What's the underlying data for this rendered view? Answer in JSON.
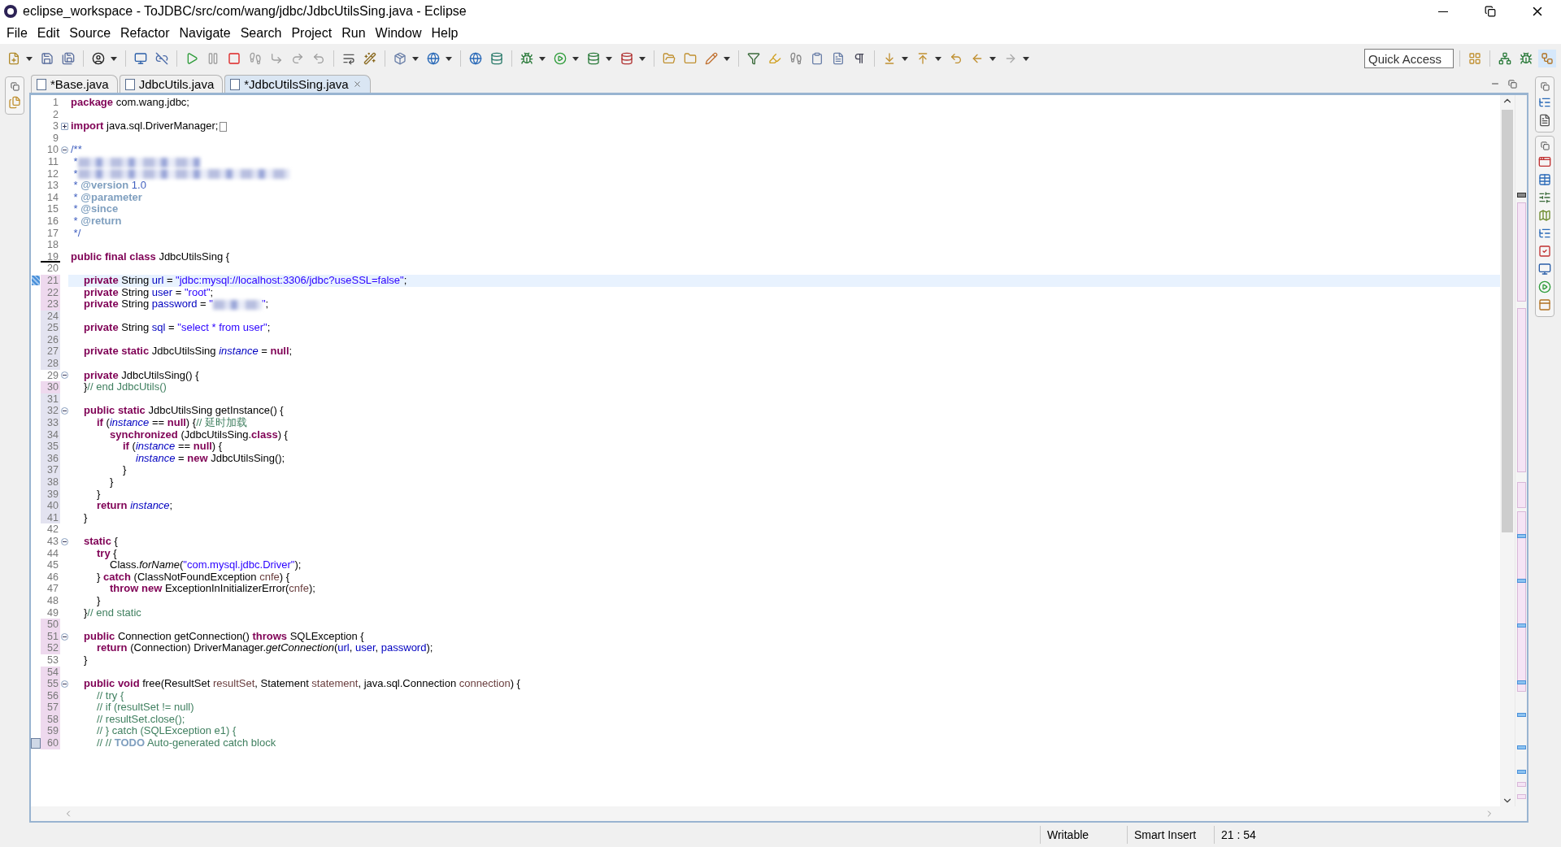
{
  "window": {
    "title": "eclipse_workspace - ToJDBC/src/com/wang/jdbc/JdbcUtilsSing.java - Eclipse"
  },
  "menu": [
    "File",
    "Edit",
    "Source",
    "Refactor",
    "Navigate",
    "Search",
    "Project",
    "Run",
    "Window",
    "Help"
  ],
  "quick_access": {
    "placeholder": "Quick Access"
  },
  "tabs": [
    {
      "label": "*Base.java",
      "selected": false
    },
    {
      "label": "JdbcUtils.java",
      "selected": false
    },
    {
      "label": "*JdbcUtilsSing.java",
      "selected": true
    }
  ],
  "lines": [
    {
      "n": "1",
      "tokens": [
        {
          "t": "package",
          "kind": "kw"
        },
        {
          "t": " com.wang.jdbc;",
          "kind": "plain"
        }
      ]
    },
    {
      "n": "2"
    },
    {
      "n": "3",
      "expanded": false,
      "tokens": [
        {
          "t": "import",
          "kind": "kw"
        },
        {
          "t": " java.sql.DriverManager;",
          "kind": "plain"
        }
      ]
    },
    {
      "n": "9"
    },
    {
      "n": "10",
      "expanded": true,
      "tokens": [
        {
          "t": "/**",
          "kind": "jd"
        }
      ]
    },
    {
      "n": "11",
      "tokens": [
        {
          "t": " *",
          "kind": "jd"
        },
        {
          "redacted": true,
          "kind": "jd"
        }
      ]
    },
    {
      "n": "12",
      "tokens": [
        {
          "t": " *",
          "kind": "jd"
        },
        {
          "redacted": true,
          "kind": "jd"
        }
      ]
    },
    {
      "n": "13",
      "tokens": [
        {
          "t": " * ",
          "kind": "jd"
        },
        {
          "t": "@version",
          "kind": "tag"
        },
        {
          "t": " 1.0",
          "kind": "jd"
        }
      ]
    },
    {
      "n": "14",
      "tokens": [
        {
          "t": " * ",
          "kind": "jd"
        },
        {
          "t": "@parameter",
          "kind": "tag"
        }
      ]
    },
    {
      "n": "15",
      "tokens": [
        {
          "t": " * ",
          "kind": "jd"
        },
        {
          "t": "@since",
          "kind": "tag"
        }
      ]
    },
    {
      "n": "16",
      "tokens": [
        {
          "t": " * ",
          "kind": "jd"
        },
        {
          "t": "@return",
          "kind": "tag"
        }
      ]
    },
    {
      "n": "17",
      "tokens": [
        {
          "t": " */",
          "kind": "jd"
        }
      ]
    },
    {
      "n": "18"
    },
    {
      "n": "19",
      "kind": "deleted",
      "tokens": [
        {
          "t": "public final class",
          "kind": "kw"
        },
        {
          "t": " JdbcUtilsSing {",
          "kind": "plain"
        }
      ]
    },
    {
      "n": "20"
    },
    {
      "n": "21",
      "current": true,
      "kind": "changed",
      "tokens": [
        {
          "t": "\tprivate",
          "kind": "kw"
        },
        {
          "t": " String ",
          "kind": "plain"
        },
        {
          "t": "url",
          "kind": "field"
        },
        {
          "t": " = ",
          "kind": "plain"
        },
        {
          "t": "\"jdbc:mysql://localhost:3306/jdbc?useSSL=false\"",
          "kind": "str"
        },
        {
          "t": ";",
          "kind": "plain"
        }
      ]
    },
    {
      "n": "22",
      "kind": "changed",
      "tokens": [
        {
          "t": "\tprivate",
          "kind": "kw"
        },
        {
          "t": " String ",
          "kind": "plain"
        },
        {
          "t": "user",
          "kind": "field"
        },
        {
          "t": " = ",
          "kind": "plain"
        },
        {
          "t": "\"root\"",
          "kind": "str"
        },
        {
          "t": ";",
          "kind": "plain"
        }
      ]
    },
    {
      "n": "23",
      "kind": "changed",
      "tokens": [
        {
          "t": "\tprivate",
          "kind": "kw"
        },
        {
          "t": " String ",
          "kind": "plain"
        },
        {
          "t": "password",
          "kind": "field"
        },
        {
          "t": " = ",
          "kind": "plain"
        },
        {
          "t": "\"",
          "kind": "str"
        },
        {
          "redacted": true,
          "kind": "str"
        },
        {
          "t": "\"",
          "kind": "str"
        },
        {
          "t": ";",
          "kind": "plain"
        }
      ]
    },
    {
      "n": "24",
      "kind": "added"
    },
    {
      "n": "25",
      "kind": "added",
      "tokens": [
        {
          "t": "\tprivate",
          "kind": "kw"
        },
        {
          "t": " String ",
          "kind": "plain"
        },
        {
          "t": "sql",
          "kind": "field"
        },
        {
          "t": " = ",
          "kind": "plain"
        },
        {
          "t": "\"select * from user\"",
          "kind": "str"
        },
        {
          "t": ";",
          "kind": "plain"
        }
      ]
    },
    {
      "n": "26",
      "kind": "added"
    },
    {
      "n": "27",
      "kind": "added",
      "tokens": [
        {
          "t": "\tprivate static",
          "kind": "kw"
        },
        {
          "t": " JdbcUtilsSing ",
          "kind": "plain"
        },
        {
          "t": "instance",
          "kind": "sfield"
        },
        {
          "t": " = ",
          "kind": "plain"
        },
        {
          "t": "null",
          "kind": "kw"
        },
        {
          "t": ";",
          "kind": "plain"
        }
      ]
    },
    {
      "n": "28",
      "kind": "added"
    },
    {
      "n": "29",
      "expanded": true,
      "tokens": [
        {
          "t": "\tprivate",
          "kind": "kw"
        },
        {
          "t": " JdbcUtilsSing() {",
          "kind": "plain"
        }
      ]
    },
    {
      "n": "30",
      "kind": "changed",
      "tokens": [
        {
          "t": "\t}",
          "kind": "plain"
        },
        {
          "t": "// end JdbcUtils()",
          "kind": "cm"
        }
      ]
    },
    {
      "n": "31",
      "kind": "added"
    },
    {
      "n": "32",
      "kind": "added",
      "expanded": true,
      "tokens": [
        {
          "t": "\tpublic static",
          "kind": "kw"
        },
        {
          "t": " JdbcUtilsSing getInstance() {",
          "kind": "plain"
        }
      ]
    },
    {
      "n": "33",
      "kind": "added",
      "tokens": [
        {
          "t": "\t\tif",
          "kind": "kw"
        },
        {
          "t": " (",
          "kind": "plain"
        },
        {
          "t": "instance",
          "kind": "sfield"
        },
        {
          "t": " == ",
          "kind": "plain"
        },
        {
          "t": "null",
          "kind": "kw"
        },
        {
          "t": ") {",
          "kind": "plain"
        },
        {
          "t": "// 延时加载",
          "kind": "cm"
        }
      ]
    },
    {
      "n": "34",
      "kind": "added",
      "tokens": [
        {
          "t": "\t\t\tsynchronized",
          "kind": "kw"
        },
        {
          "t": " (JdbcUtilsSing.",
          "kind": "plain"
        },
        {
          "t": "class",
          "kind": "kw"
        },
        {
          "t": ") {",
          "kind": "plain"
        }
      ]
    },
    {
      "n": "35",
      "kind": "added",
      "tokens": [
        {
          "t": "\t\t\t\tif",
          "kind": "kw"
        },
        {
          "t": " (",
          "kind": "plain"
        },
        {
          "t": "instance",
          "kind": "sfield"
        },
        {
          "t": " == ",
          "kind": "plain"
        },
        {
          "t": "null",
          "kind": "kw"
        },
        {
          "t": ") {",
          "kind": "plain"
        }
      ]
    },
    {
      "n": "36",
      "kind": "added",
      "tokens": [
        {
          "t": "\t\t\t\t\tinstance",
          "kind": "sfield"
        },
        {
          "t": " = ",
          "kind": "plain"
        },
        {
          "t": "new",
          "kind": "kw"
        },
        {
          "t": " JdbcUtilsSing();",
          "kind": "plain"
        }
      ]
    },
    {
      "n": "37",
      "kind": "added",
      "tokens": [
        {
          "t": "\t\t\t\t}",
          "kind": "plain"
        }
      ]
    },
    {
      "n": "38",
      "kind": "added",
      "tokens": [
        {
          "t": "\t\t\t}",
          "kind": "plain"
        }
      ]
    },
    {
      "n": "39",
      "kind": "added",
      "tokens": [
        {
          "t": "\t\t}",
          "kind": "plain"
        }
      ]
    },
    {
      "n": "40",
      "kind": "added",
      "tokens": [
        {
          "t": "\t\treturn ",
          "kind": "kw"
        },
        {
          "t": "instance",
          "kind": "sfield"
        },
        {
          "t": ";",
          "kind": "plain"
        }
      ]
    },
    {
      "n": "41",
      "kind": "added",
      "tokens": [
        {
          "t": "\t}",
          "kind": "plain"
        }
      ]
    },
    {
      "n": "42"
    },
    {
      "n": "43",
      "expanded": true,
      "tokens": [
        {
          "t": "\tstatic",
          "kind": "kw"
        },
        {
          "t": " {",
          "kind": "plain"
        }
      ]
    },
    {
      "n": "44",
      "tokens": [
        {
          "t": "\t\ttry",
          "kind": "kw"
        },
        {
          "t": " {",
          "kind": "plain"
        }
      ]
    },
    {
      "n": "45",
      "tokens": [
        {
          "t": "\t\t\tClass.",
          "kind": "plain"
        },
        {
          "t": "forName",
          "kind": "smethod"
        },
        {
          "t": "(",
          "kind": "plain"
        },
        {
          "t": "\"com.mysql.jdbc.Driver\"",
          "kind": "str"
        },
        {
          "t": ");",
          "kind": "plain"
        }
      ]
    },
    {
      "n": "46",
      "tokens": [
        {
          "t": "\t\t} ",
          "kind": "plain"
        },
        {
          "t": "catch",
          "kind": "kw"
        },
        {
          "t": " (ClassNotFoundException ",
          "kind": "plain"
        },
        {
          "t": "cnfe",
          "kind": "local"
        },
        {
          "t": ") {",
          "kind": "plain"
        }
      ]
    },
    {
      "n": "47",
      "tokens": [
        {
          "t": "\t\t\tthrow new",
          "kind": "kw"
        },
        {
          "t": " ExceptionInInitializerError(",
          "kind": "plain"
        },
        {
          "t": "cnfe",
          "kind": "local"
        },
        {
          "t": ");",
          "kind": "plain"
        }
      ]
    },
    {
      "n": "48",
      "tokens": [
        {
          "t": "\t\t}",
          "kind": "plain"
        }
      ]
    },
    {
      "n": "49",
      "tokens": [
        {
          "t": "\t}",
          "kind": "plain"
        },
        {
          "t": "// end static",
          "kind": "cm"
        }
      ]
    },
    {
      "n": "50",
      "kind": "changed"
    },
    {
      "n": "51",
      "kind": "changed",
      "expanded": true,
      "tokens": [
        {
          "t": "\tpublic",
          "kind": "kw"
        },
        {
          "t": " Connection getConnection() ",
          "kind": "plain"
        },
        {
          "t": "throws",
          "kind": "kw"
        },
        {
          "t": " SQLException {",
          "kind": "plain"
        }
      ]
    },
    {
      "n": "52",
      "kind": "changed",
      "tokens": [
        {
          "t": "\t\treturn",
          "kind": "kw"
        },
        {
          "t": " (Connection) DriverManager.",
          "kind": "plain"
        },
        {
          "t": "getConnection",
          "kind": "smethod"
        },
        {
          "t": "(",
          "kind": "plain"
        },
        {
          "t": "url",
          "kind": "field"
        },
        {
          "t": ", ",
          "kind": "plain"
        },
        {
          "t": "user",
          "kind": "field"
        },
        {
          "t": ", ",
          "kind": "plain"
        },
        {
          "t": "password",
          "kind": "field"
        },
        {
          "t": ");",
          "kind": "plain"
        }
      ]
    },
    {
      "n": "53",
      "tokens": [
        {
          "t": "\t}",
          "kind": "plain"
        }
      ]
    },
    {
      "n": "54",
      "kind": "changed"
    },
    {
      "n": "55",
      "kind": "changed",
      "expanded": true,
      "tokens": [
        {
          "t": "\tpublic void",
          "kind": "kw"
        },
        {
          "t": " free(ResultSet ",
          "kind": "plain"
        },
        {
          "t": "resultSet",
          "kind": "local"
        },
        {
          "t": ", Statement ",
          "kind": "plain"
        },
        {
          "t": "statement",
          "kind": "local"
        },
        {
          "t": ", java.sql.Connection ",
          "kind": "plain"
        },
        {
          "t": "connection",
          "kind": "local"
        },
        {
          "t": ") {",
          "kind": "plain"
        }
      ]
    },
    {
      "n": "56",
      "kind": "changed",
      "tokens": [
        {
          "t": "\t\t// try {",
          "kind": "cm"
        }
      ]
    },
    {
      "n": "57",
      "kind": "changed",
      "tokens": [
        {
          "t": "\t\t// if (resultSet != null)",
          "kind": "cm"
        }
      ]
    },
    {
      "n": "58",
      "kind": "changed",
      "tokens": [
        {
          "t": "\t\t// resultSet.close();",
          "kind": "cm"
        }
      ]
    },
    {
      "n": "59",
      "kind": "changed",
      "tokens": [
        {
          "t": "\t\t// } catch (SQLException e1) {",
          "kind": "cm"
        }
      ]
    },
    {
      "n": "60",
      "kind": "changed",
      "task": true,
      "tokens": [
        {
          "t": "\t\t// // ",
          "kind": "cm"
        },
        {
          "t": "TODO",
          "kind": "tag"
        },
        {
          "t": " Auto-generated catch block",
          "kind": "cm"
        }
      ]
    }
  ],
  "status_bar": {
    "mode": "Writable",
    "insert": "Smart Insert",
    "position": "21 : 54"
  }
}
